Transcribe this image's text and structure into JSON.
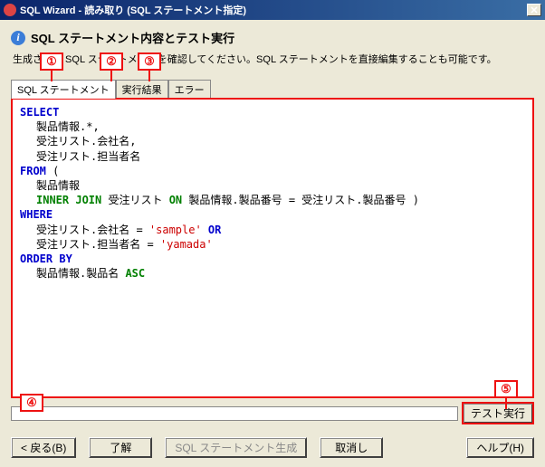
{
  "titlebar": {
    "text": "SQL Wizard - 読み取り (SQL ステートメント指定)"
  },
  "header": {
    "title": "SQL ステートメント内容とテスト実行",
    "description": "生成された SQL ステートメントを確認してください。SQL ステートメントを直接編集することも可能です。"
  },
  "tabs": {
    "t1": "SQL ステートメント",
    "t2": "実行結果",
    "t3": "エラー"
  },
  "sql": {
    "select": "SELECT",
    "select_f1": "製品情報.*,",
    "select_f2": "受注リスト.会社名,",
    "select_f3": "受注リスト.担当者名",
    "from": "FROM",
    "from_paren": " (",
    "from_t1": "製品情報",
    "inner_join": "INNER JOIN",
    "join_t": " 受注リスト ",
    "on": "ON",
    "on_cond": " 製品情報.製品番号 = 受注リスト.製品番号 )",
    "where": "WHERE",
    "where_c1a": "受注リスト.会社名 = ",
    "where_v1": "'sample'",
    "or": " OR",
    "where_c2a": "受注リスト.担当者名 = ",
    "where_v2": "'yamada'",
    "orderby": "ORDER BY",
    "orderby_f": "製品情報.製品名 ",
    "asc": "ASC"
  },
  "buttons": {
    "test": "テスト実行",
    "back": "< 戻る(B)",
    "ok": "了解",
    "gen": "SQL ステートメント生成",
    "cancel": "取消し",
    "help": "ヘルプ(H)"
  },
  "callouts": {
    "c1": "①",
    "c2": "②",
    "c3": "③",
    "c4": "④",
    "c5": "⑤"
  }
}
